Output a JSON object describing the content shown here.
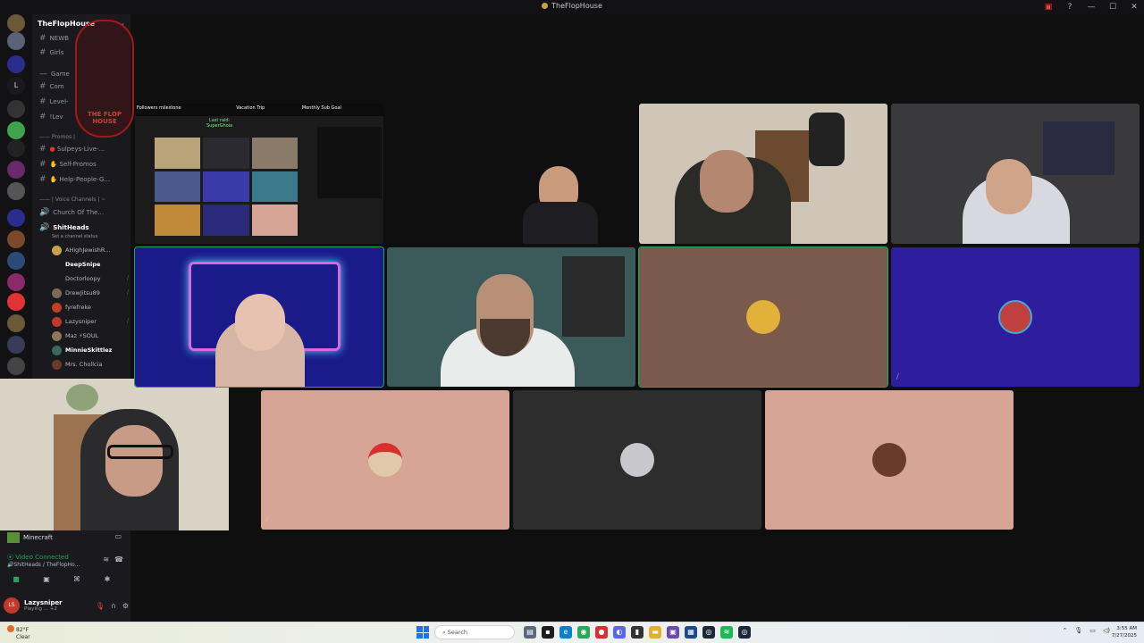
{
  "window": {
    "title": "TheFlopHouse"
  },
  "sidebar": {
    "server_name": "TheFlopHouse",
    "channels": [
      {
        "name": "NEWB",
        "prefix": "#"
      },
      {
        "name": "Girls",
        "prefix": "#"
      },
      {
        "name": "Game",
        "prefix": "#"
      },
      {
        "name": "Com",
        "prefix": "#"
      },
      {
        "name": "Level-",
        "prefix": "#"
      },
      {
        "name": "!Lev",
        "prefix": "#"
      }
    ],
    "category_promos": "Promos |",
    "promo_channels": [
      {
        "name": "Sulpeys-Live-..."
      },
      {
        "name": "Self-Promos"
      },
      {
        "name": "Help-People-G..."
      }
    ],
    "category_voice": "Voice Channels | ~",
    "voice_channels": [
      {
        "name": "Church Of The..."
      },
      {
        "name": "ShitHeads"
      }
    ],
    "channel_status_placeholder": "Set a channel status",
    "voice_users": [
      {
        "name": "AHighJewishR...",
        "bright": false
      },
      {
        "name": "DeepSnipe",
        "bright": true
      },
      {
        "name": "Doctorloopy",
        "bright": false
      },
      {
        "name": "DrewJitsu89",
        "bright": false
      },
      {
        "name": "fyrefreke",
        "bright": false
      },
      {
        "name": "Lazysniper",
        "bright": false
      },
      {
        "name": "Maz ⚡SOUL",
        "bright": false
      },
      {
        "name": "MinnieSkittlez",
        "bright": true
      },
      {
        "name": "Mrs. Chollcia",
        "bright": false
      }
    ],
    "logo_text": "THE FLOP HOUSE"
  },
  "voice_panel": {
    "activity": "Minecraft",
    "status": "Video Connected",
    "channel_path": "ShitHeads / TheFlopHo..."
  },
  "user": {
    "name": "Lazysniper",
    "status": "Playing ... +2",
    "avatar_text": "LS"
  },
  "stream": {
    "header_left": "Followers milestone",
    "header_mid": "Vacation Trip",
    "header_right": "Monthly Sub Goal",
    "last_raid_label": "Last raid:",
    "last_raid_name": "SuperGhoia"
  },
  "taskbar": {
    "weather_temp": "82°F",
    "weather_desc": "Clear",
    "search_placeholder": "Search",
    "time": "3:55 AM",
    "date": "7/27/2025"
  },
  "colors": {
    "tile_brown": "#7a5a4c",
    "tile_purple": "#2e1d9c",
    "tile_pink": "#d6a596",
    "tile_gray": "#2d2d2e",
    "speaking": "#23a55a"
  }
}
